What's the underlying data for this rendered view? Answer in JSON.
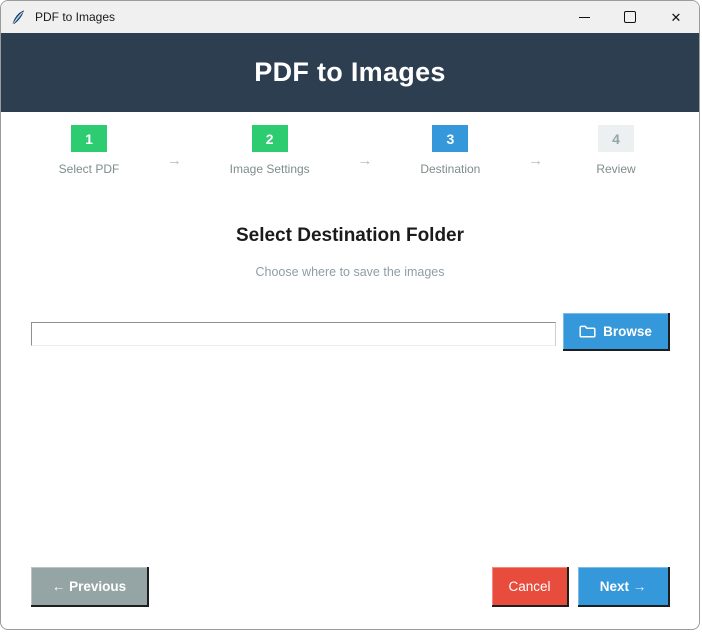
{
  "window": {
    "titlebar": {
      "title": "PDF to Images",
      "icon": "feather-icon",
      "controls": {
        "minimize": "minimize",
        "maximize": "maximize",
        "close": "✕"
      }
    }
  },
  "header": {
    "title": "PDF to Images"
  },
  "wizard": {
    "arrow_glyph": "→",
    "steps": [
      {
        "number": "1",
        "label": "Select PDF",
        "state": "complete"
      },
      {
        "number": "2",
        "label": "Image Settings",
        "state": "complete"
      },
      {
        "number": "3",
        "label": "Destination",
        "state": "active"
      },
      {
        "number": "4",
        "label": "Review",
        "state": "pending"
      }
    ]
  },
  "content": {
    "heading": "Select Destination Folder",
    "subheading": "Choose where to save the images",
    "destination_field": {
      "value": "",
      "placeholder": ""
    },
    "browse_label": "Browse"
  },
  "footer": {
    "previous_label": "← Previous",
    "cancel_label": "Cancel",
    "next_label": "Next →"
  },
  "colors": {
    "titlebar_bg": "#f0f0f0",
    "header_bg": "#2c3e50",
    "step_complete": "#2ecc71",
    "step_active": "#3498db",
    "step_idle_bg": "#ecf0f1",
    "step_label": "#7f8c8d",
    "arrow": "#b4bcc2",
    "accent_blue": "#3498db",
    "cancel_red": "#e74c3c",
    "previous_gray": "#95a5a6"
  }
}
